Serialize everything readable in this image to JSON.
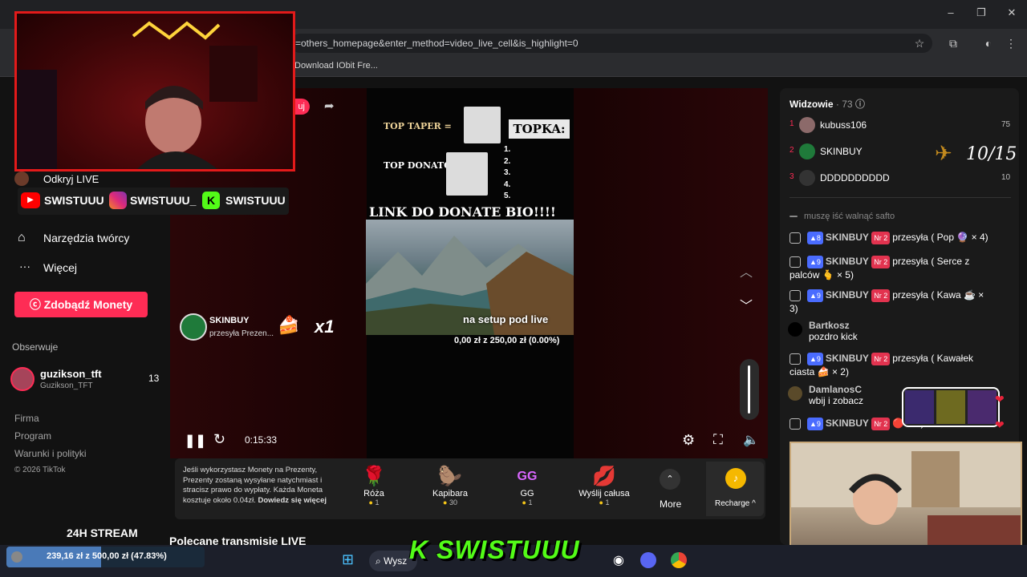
{
  "browser": {
    "url": "=others_homepage&enter_method=video_live_cell&is_highlight=0",
    "bookmark": "Download IObit Fre...",
    "win_min": "–",
    "win_max": "❐",
    "win_close": "✕"
  },
  "nav": {
    "partial_button": "uj",
    "creator_live": "Odkryj LIVE",
    "creator_tools": "Narzędzia twórcy",
    "more": "Więcej",
    "get_coins": "Zdobądź Monety",
    "following_heading": "Obserwuje",
    "following": [
      {
        "name": "guzikson_tft",
        "handle": "Guzikson_TFT",
        "count": "13"
      }
    ],
    "footer": [
      "Firma",
      "Program",
      "Warunki i polityki",
      "© 2026 TikTok"
    ]
  },
  "socials": [
    "SWISTUUU",
    "SWISTUUU_",
    "SWISTUUU"
  ],
  "stream_overlay": {
    "top_taper": "TOP TAPER =",
    "topka": "TOPKA:",
    "top_donator": "TOP DONATOR:",
    "ranks": [
      "1.",
      "2.",
      "3.",
      "4.",
      "5."
    ],
    "link_donate": "LINK DO DONATE BIO!!!!",
    "setup_caption": "na setup pod live",
    "goal_text": "0,00 zł z 250,00 zł (0.00%)",
    "gift_notice_user": "SKINBUY",
    "gift_notice_text": "przesyła Prezen...",
    "gift_multiplier": "x1"
  },
  "player": {
    "time": "0:15:33"
  },
  "giftbar": {
    "info": "Jeśli wykorzystasz Monety na Prezenty, Prezenty zostaną wysyłane natychmiast i stracisz prawo do wypłaty. Każda Moneta kosztuje około 0.04zł.",
    "info_link": "Dowiedz się więcej",
    "gifts": [
      {
        "name": "Róża",
        "price": "1",
        "icon": "rose-icon"
      },
      {
        "name": "Kapibara",
        "price": "30",
        "icon": "capybara-icon"
      },
      {
        "name": "GG",
        "price": "1",
        "icon": "gg-icon"
      },
      {
        "name": "Wyślij całusa",
        "price": "1",
        "icon": "lips-icon"
      }
    ],
    "more": "More",
    "recharge": "Recharge ^"
  },
  "viewers": {
    "title": "Widzowie",
    "count": "· 73",
    "top": [
      {
        "rank": "1",
        "name": "kubuss106",
        "score": "75"
      },
      {
        "rank": "2",
        "name": "SKINBUY",
        "score": ""
      },
      {
        "rank": "3",
        "name": "DDDDDDDDDD",
        "score": "10"
      }
    ]
  },
  "counter": "10/15",
  "chat": {
    "partial": "muszę iść walnąć safto",
    "messages": [
      {
        "user": "SKINBUY",
        "lvl": "8",
        "nr": "Nr 2",
        "text": "przesyła ( Pop 🔮 × 4)"
      },
      {
        "user": "SKINBUY",
        "lvl": "9",
        "nr": "Nr 2",
        "text": "przesyła ( Serce z palców 🫰 × 5)"
      },
      {
        "user": "SKINBUY",
        "lvl": "9",
        "nr": "Nr 2",
        "text": "przesyła ( Kawa ☕ × 3)"
      },
      {
        "user": "Bartkosz",
        "text": "pozdro kick"
      },
      {
        "user": "SKINBUY",
        "lvl": "9",
        "nr": "Nr 2",
        "text": "przesyła ( Kawałek ciasta 🍰 × 2)"
      },
      {
        "user": "DamlanosC",
        "text": "wbij i zobacz"
      },
      {
        "user": "SKINBUY",
        "lvl": "9",
        "nr": "Nr 2",
        "text": "🔴 × 3)"
      }
    ]
  },
  "bottom_overlay": {
    "stream_24h": "24H STREAM",
    "recommended": "Polecane transmisje LIVE",
    "goal_progress": "239,16 zł z 500,00 zł (47.83%)",
    "goal_fraction": 0.4783,
    "kick_name": "SWISTUUU",
    "search_partial": "Wysz"
  },
  "colors": {
    "accent": "#fe2c55",
    "kick_green": "#53fc18",
    "webcam_border": "#e31a1a"
  }
}
